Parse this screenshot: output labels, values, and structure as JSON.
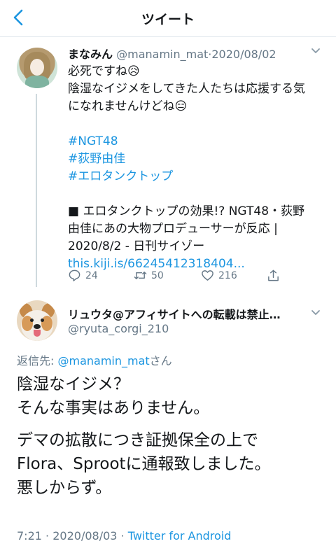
{
  "header": {
    "title": "ツイート"
  },
  "tweet1": {
    "name": "まなみん",
    "handle": "@manamin_mat",
    "separator": "·",
    "date": "2020/08/02",
    "lines": [
      "必死ですね😥",
      "陰湿なイジメをしてきた人たちは応援する気",
      "になれませんけどね😑"
    ],
    "hashtags": [
      "#NGT48",
      "#荻野由佳",
      "#エロタンクトップ"
    ],
    "card_lines": [
      "■ エロタンクトップの効果!? NGT48・荻野",
      "由佳にあの大物プロデューサーが反応 |",
      "2020/8/2 - 日刊サイゾー"
    ],
    "card_link": "this.kiji.is/66245412318404...",
    "replies": "24",
    "retweets": "50",
    "likes": "216"
  },
  "tweet2": {
    "name": "リュウタ@アフィサイトへの転載は禁止…",
    "handle": "@ryuta_corgi_210",
    "reply_prefix": "返信先: ",
    "reply_to": "@manamin_mat",
    "reply_suffix": "さん",
    "text_lines_a": [
      "陰湿なイジメ？",
      "そんな事実はありません。"
    ],
    "text_lines_b": [
      "デマの拡散につき証拠保全の上で",
      "Flora、Sprootに通報致しました。",
      "悪しからず。"
    ],
    "time": "7:21",
    "separator": "·",
    "date": "2020/08/03",
    "separator2": "·",
    "client": "Twitter for Android"
  },
  "colors": {
    "accent": "#1b95e0",
    "muted": "#657786",
    "text": "#14171a"
  }
}
